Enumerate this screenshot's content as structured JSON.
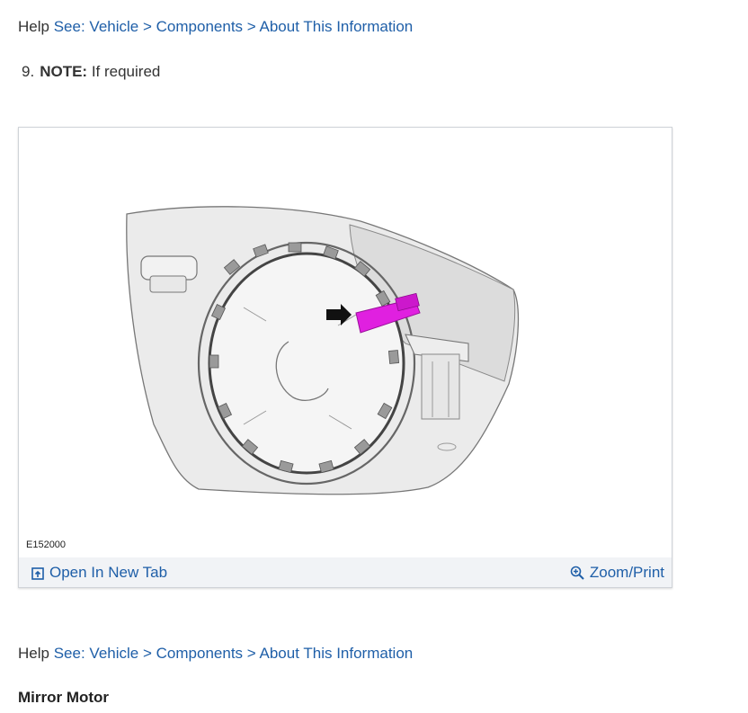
{
  "help_top": {
    "help_word": "Help",
    "see": "See:",
    "crumbs": [
      "Vehicle",
      "Components",
      "About This Information"
    ],
    "separator": ">"
  },
  "step": {
    "number": "9.",
    "note_label": "NOTE:",
    "note_text": "If required"
  },
  "figure": {
    "id": "E152000",
    "open_in_new_tab": "Open In New Tab",
    "zoom_print": "Zoom/Print",
    "icons": [
      "open-in-new-tab-icon",
      "zoom-icon"
    ],
    "highlight_color": "#e020e0",
    "link_color": "#1f5fa8"
  },
  "help_bottom": {
    "help_word": "Help",
    "see": "See:",
    "crumbs": [
      "Vehicle",
      "Components",
      "About This Information"
    ],
    "separator": ">"
  },
  "section": {
    "title": "Mirror Motor"
  }
}
